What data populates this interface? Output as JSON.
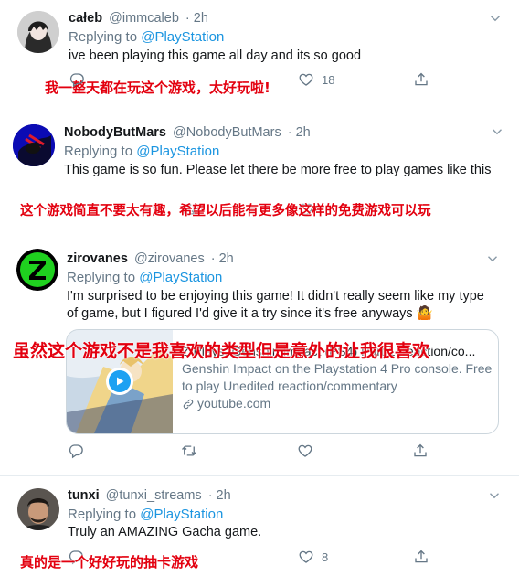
{
  "tweets": [
    {
      "name": "całeb",
      "handle": "@immcaleb",
      "time": "· 2h",
      "replying_prefix": "Replying to",
      "replying_to": "@PlayStation",
      "text": "ive been playing this game all day and its so good",
      "likes": "18",
      "annotation": "我一整天都在玩这个游戏，太好玩啦!"
    },
    {
      "name": "NobodyButMars",
      "handle": "@NobodyButMars",
      "time": "· 2h",
      "replying_prefix": "Replying to",
      "replying_to": "@PlayStation",
      "text": "This game is so fun. Please let there be more free to play games like this",
      "annotation": "这个游戏简直不要太有趣，希望以后能有更多像这样的免费游戏可以玩"
    },
    {
      "name": "zirovanes",
      "handle": "@zirovanes",
      "time": "· 2h",
      "replying_prefix": "Replying to",
      "replying_to": "@PlayStation",
      "text": "I'm surprised to be enjoying this game! It didn't really seem like my type of game, but I figured I'd give it a try since it's free anyways 🤷",
      "annotation": "虽然这个游戏不是我喜欢的类型但是意外的让我很喜欢",
      "card": {
        "title": "Z Plays: Genshin Impact (PS4) Part 1 [reaction/co...",
        "description": "Genshin Impact on the Playstation 4 Pro console. Free to play Unedited reaction/commentary",
        "link": "youtube.com"
      }
    },
    {
      "name": "tunxi",
      "handle": "@tunxi_streams",
      "time": "· 2h",
      "replying_prefix": "Replying to",
      "replying_to": "@PlayStation",
      "text": "Truly an AMAZING Gacha game.",
      "likes": "8",
      "annotation": "真的是一个好好玩的抽卡游戏"
    }
  ],
  "icons": {
    "reply": "reply-icon",
    "retweet": "retweet-icon",
    "like": "heart-icon",
    "share": "share-icon",
    "more": "chevron-down-icon",
    "play": "play-icon",
    "link": "link-icon"
  },
  "colors": {
    "accent": "#1b95e0",
    "annotation": "#e3000f",
    "muted": "#657786"
  }
}
